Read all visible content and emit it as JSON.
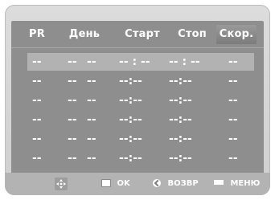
{
  "table": {
    "headers": [
      "PR",
      "День",
      "Старт",
      "Стоп",
      "Скор."
    ],
    "rows": [
      {
        "pr": "--",
        "day1": "--",
        "day2": "--",
        "start": "-- : --",
        "stop": "-- : --",
        "speed": "--"
      },
      {
        "pr": "--",
        "day1": "--",
        "day2": "--",
        "start": "--:--",
        "stop": "--:--",
        "speed": "--"
      },
      {
        "pr": "--",
        "day1": "--",
        "day2": "--",
        "start": "--:--",
        "stop": "--:--",
        "speed": "--"
      },
      {
        "pr": "--",
        "day1": "--",
        "day2": "--",
        "start": "--:--",
        "stop": "--:--",
        "speed": "--"
      },
      {
        "pr": "--",
        "day1": "--",
        "day2": "--",
        "start": "--:--",
        "stop": "--:--",
        "speed": "--"
      },
      {
        "pr": "--",
        "day1": "--",
        "day2": "--",
        "start": "--:--",
        "stop": "--:--",
        "speed": "--"
      }
    ]
  },
  "footer": {
    "ok_label": "OK",
    "back_label": "ВОЗВР",
    "menu_label": "МЕНЮ"
  },
  "icons": {
    "nav": "dpad-icon",
    "ok": "ok-button-icon",
    "back": "return-icon",
    "menu": "menu-icon"
  }
}
